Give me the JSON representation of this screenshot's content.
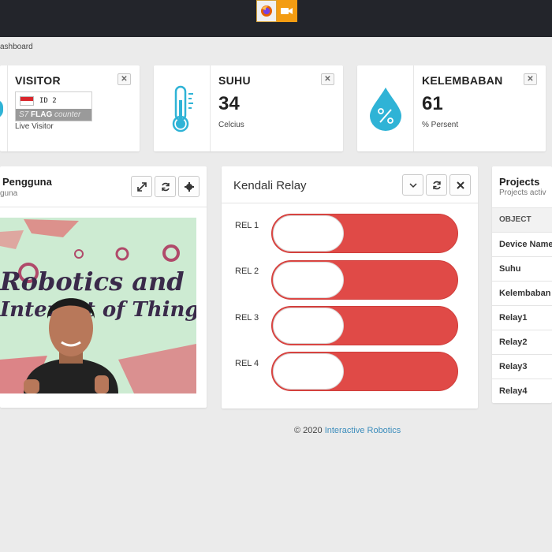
{
  "topbar": {
    "icons": [
      "firefox-icon",
      "camera-icon"
    ]
  },
  "breadcrumb": "ashboard",
  "stats": {
    "visitor": {
      "title": "VISITOR",
      "flag_id": "ID  2",
      "flag_brand": "FLAG",
      "flag_brand2": "counter",
      "flag_brand_prefix": "S7",
      "caption": "Live Visitor"
    },
    "suhu": {
      "title": "SUHU",
      "value": "34",
      "unit": "Celcius"
    },
    "kelembaban": {
      "title": "KELEMBABAN",
      "value": "61",
      "unit": "% Persent"
    }
  },
  "pengguna": {
    "title": "Pengguna",
    "subtitle": "guna"
  },
  "camera_text": {
    "line1": "Robotics and",
    "line2": "Internet of Things"
  },
  "relay": {
    "title": "Kendali Relay",
    "items": [
      {
        "label": "REL 1",
        "state": "off"
      },
      {
        "label": "REL 2",
        "state": "off"
      },
      {
        "label": "REL 3",
        "state": "off"
      },
      {
        "label": "REL 4",
        "state": "off"
      }
    ]
  },
  "projects": {
    "title": "Projects",
    "subtitle": "Projects activ",
    "header": "OBJECT",
    "rows": [
      "Device Name",
      "Suhu",
      "Kelembaban",
      "Relay1",
      "Relay2",
      "Relay3",
      "Relay4"
    ]
  },
  "footer": {
    "text": "© 2020",
    "link": "Interactive Robotics"
  },
  "colors": {
    "topbar": "#23252b",
    "relay_off": "#e04a47",
    "drop_icon": "#2fb3d6",
    "thermometer": "#2fb3d6",
    "link": "#3c8dbc"
  }
}
